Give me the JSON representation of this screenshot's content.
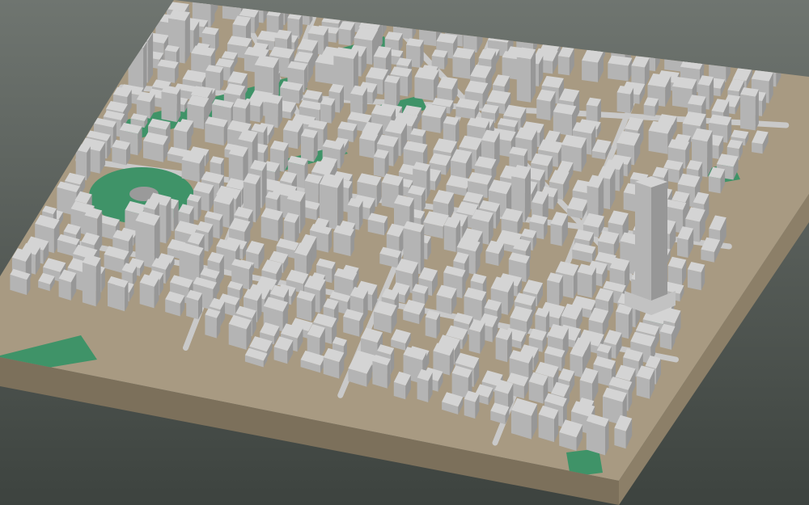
{
  "scene": {
    "subject": "3d-city-block-model",
    "colors": {
      "background_top": "#6f7570",
      "background_bottom": "#3d433f",
      "base_side": "#8c7f68",
      "base_front": "#7c705b",
      "ground": "#a89a82",
      "road": "#c9c9c9",
      "park": "#3f9368",
      "building_top": "#d4d4d4",
      "building_left": "#b4b4b4",
      "building_right": "#979797"
    }
  }
}
